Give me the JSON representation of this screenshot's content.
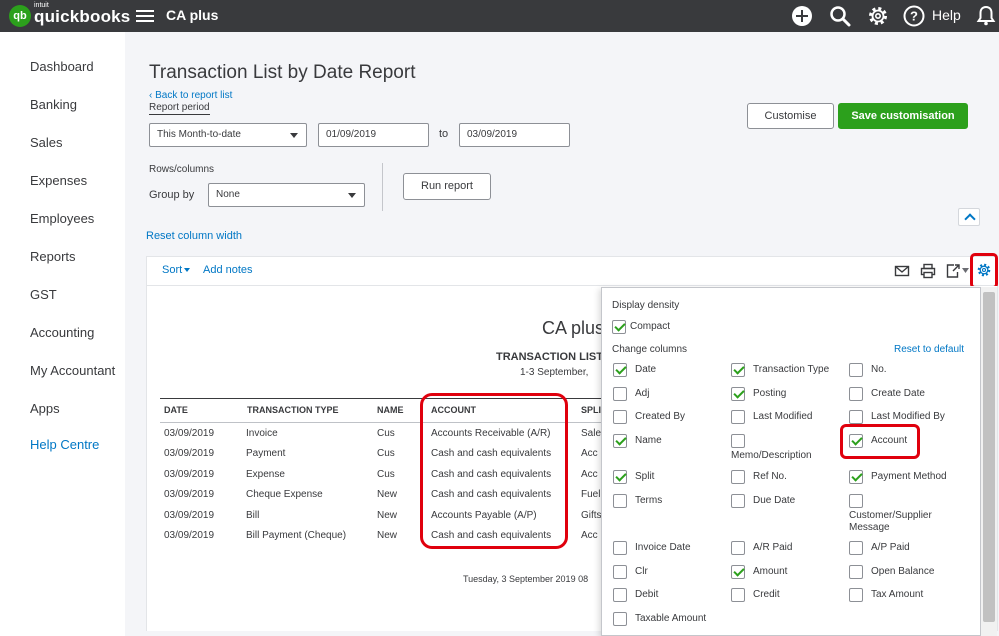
{
  "app": {
    "logo_mark": "qb",
    "logo_intuit": "intuit",
    "logo_text": "quickbooks",
    "company": "CA plus",
    "help_label": "Help"
  },
  "icons": {
    "plus": "plus-circle-icon",
    "search": "search-icon",
    "settings": "gear-icon",
    "help": "help-circle-icon",
    "notifications": "bell-icon"
  },
  "sidebar": {
    "items": [
      {
        "label": "Dashboard"
      },
      {
        "label": "Banking"
      },
      {
        "label": "Sales"
      },
      {
        "label": "Expenses"
      },
      {
        "label": "Employees"
      },
      {
        "label": "Reports"
      },
      {
        "label": "GST"
      },
      {
        "label": "Accounting"
      },
      {
        "label": "My Accountant"
      },
      {
        "label": "Apps"
      },
      {
        "label": "Help Centre"
      }
    ]
  },
  "report": {
    "title": "Transaction List by Date Report",
    "back_link": "Back to report list",
    "period_label": "Report period",
    "period_value": "This Month-to-date",
    "date_from": "01/09/2019",
    "to_label": "to",
    "date_to": "03/09/2019",
    "rows_columns_label": "Rows/columns",
    "group_by_label": "Group by",
    "group_by_value": "None",
    "run_report": "Run report",
    "customise": "Customise",
    "save_customisation": "Save customisation",
    "reset_column_width": "Reset column width",
    "sort": "Sort",
    "add_notes": "Add notes",
    "company_name": "CA plus",
    "heading": "TRANSACTION LIST",
    "dates": "1-3 September,",
    "footer": "Tuesday, 3 September 2019  08"
  },
  "table": {
    "columns": [
      "DATE",
      "TRANSACTION TYPE",
      "NAME",
      "ACCOUNT",
      "SPLI"
    ],
    "rows": [
      [
        "03/09/2019",
        "Invoice",
        "Cus",
        "Accounts Receivable (A/R)",
        "Sale"
      ],
      [
        "03/09/2019",
        "Payment",
        "Cus",
        "Cash and cash equivalents",
        "Acc"
      ],
      [
        "03/09/2019",
        "Expense",
        "Cus",
        "Cash and cash equivalents",
        "Acc"
      ],
      [
        "03/09/2019",
        "Cheque Expense",
        "New",
        "Cash and cash equivalents",
        "Fuel"
      ],
      [
        "03/09/2019",
        "Bill",
        "New",
        "Accounts Payable (A/P)",
        "Gifts"
      ],
      [
        "03/09/2019",
        "Bill Payment (Cheque)",
        "New",
        "Cash and cash equivalents",
        "Acc"
      ]
    ]
  },
  "panel": {
    "display_density_label": "Display density",
    "compact_label": "Compact",
    "compact_checked": true,
    "change_columns_label": "Change columns",
    "reset_default": "Reset to default",
    "options": [
      {
        "label": "Date",
        "checked": true
      },
      {
        "label": "Transaction Type",
        "checked": true
      },
      {
        "label": "No.",
        "checked": false
      },
      {
        "label": "Adj",
        "checked": false
      },
      {
        "label": "Posting",
        "checked": true
      },
      {
        "label": "Create Date",
        "checked": false
      },
      {
        "label": "Created By",
        "checked": false
      },
      {
        "label": "Last Modified",
        "checked": false
      },
      {
        "label": "Last Modified By",
        "checked": false
      },
      {
        "label": "Name",
        "checked": true
      },
      {
        "label": "Memo/Description",
        "checked": false
      },
      {
        "label": "Account",
        "checked": true
      },
      {
        "label": "Split",
        "checked": true
      },
      {
        "label": "Ref No.",
        "checked": false
      },
      {
        "label": "Payment Method",
        "checked": true
      },
      {
        "label": "Terms",
        "checked": false
      },
      {
        "label": "Due Date",
        "checked": false
      },
      {
        "label": "Customer/Supplier Message",
        "checked": false
      },
      {
        "label": "Invoice Date",
        "checked": false
      },
      {
        "label": "A/R Paid",
        "checked": false
      },
      {
        "label": "A/P Paid",
        "checked": false
      },
      {
        "label": "Clr",
        "checked": false
      },
      {
        "label": "Amount",
        "checked": true
      },
      {
        "label": "Open Balance",
        "checked": false
      },
      {
        "label": "Debit",
        "checked": false
      },
      {
        "label": "Credit",
        "checked": false
      },
      {
        "label": "Tax Amount",
        "checked": false
      },
      {
        "label": "Taxable Amount",
        "checked": false
      }
    ]
  },
  "colors": {
    "topbar": "#393a3d",
    "brand_green": "#2ca01c",
    "link_blue": "#0077c5",
    "highlight_red": "#e0000d"
  }
}
